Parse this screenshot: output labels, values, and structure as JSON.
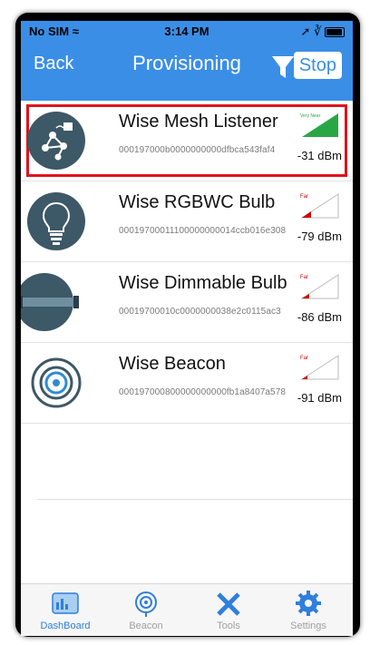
{
  "status_bar": {
    "carrier": "No SIM",
    "time": "3:14 PM"
  },
  "nav": {
    "back_label": "Back",
    "title": "Provisioning",
    "stop_label": "Stop"
  },
  "devices": [
    {
      "name": "Wise Mesh Listener",
      "id": "000197000b0000000000dfbca543faf4",
      "rssi": "-31 dBm",
      "signal_label": "Very Near",
      "signal_level": 1.0,
      "signal_color": "#29a745",
      "icon": "mesh-listener-icon",
      "selected": true
    },
    {
      "name": "Wise RGBWC Bulb",
      "id": "00019700011100000000014ccb016e308",
      "rssi": "-79 dBm",
      "signal_label": "Far",
      "signal_level": 0.25,
      "signal_color": "#d10000",
      "icon": "bulb-icon"
    },
    {
      "name": "Wise Dimmable Bulb",
      "id": "00019700010c0000000038e2c0115ac3",
      "rssi": "-86 dBm",
      "signal_label": "Far",
      "signal_level": 0.2,
      "signal_color": "#d10000",
      "icon": "tube-light-icon"
    },
    {
      "name": "Wise Beacon",
      "id": "000197000800000000000fb1a8407a578",
      "rssi": "-91 dBm",
      "signal_label": "Far",
      "signal_level": 0.15,
      "signal_color": "#d10000",
      "icon": "beacon-icon"
    }
  ],
  "tabs": [
    {
      "label": "DashBoard",
      "icon": "dashboard-icon",
      "active": true
    },
    {
      "label": "Beacon",
      "icon": "beacon-tab-icon",
      "active": false
    },
    {
      "label": "Tools",
      "icon": "tools-icon",
      "active": false
    },
    {
      "label": "Settings",
      "icon": "gear-icon",
      "active": false
    }
  ],
  "colors": {
    "accent": "#3a8ee6",
    "selection": "#e0121b",
    "icon_bg": "#3d5866"
  }
}
